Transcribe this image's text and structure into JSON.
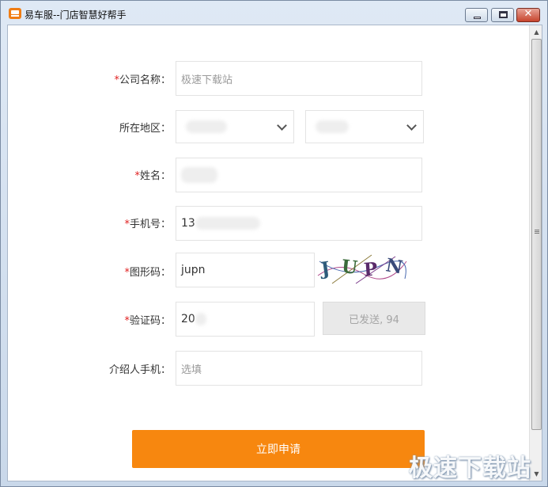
{
  "window": {
    "title": "易车服--门店智慧好帮手",
    "close_glyph": "✕"
  },
  "form": {
    "company": {
      "label": "公司名称：",
      "placeholder": "极速下载站"
    },
    "region": {
      "label": "所在地区："
    },
    "name": {
      "label": "姓名："
    },
    "phone": {
      "label": "手机号：",
      "value": "13"
    },
    "captcha": {
      "label": "图形码：",
      "value": "jupn",
      "image_text": [
        "J",
        "U",
        "P",
        "N"
      ]
    },
    "sms_code": {
      "label": "验证码：",
      "value": "20",
      "send_button": "已发送, 94"
    },
    "referrer": {
      "label": "介绍人手机：",
      "placeholder": "选填"
    },
    "required_mark": "*",
    "submit_label": "立即申请"
  },
  "watermark": "极速下载站",
  "colors": {
    "accent": "#f7870f",
    "required": "#e02020",
    "disabled_button_bg": "#e9e9e9"
  }
}
